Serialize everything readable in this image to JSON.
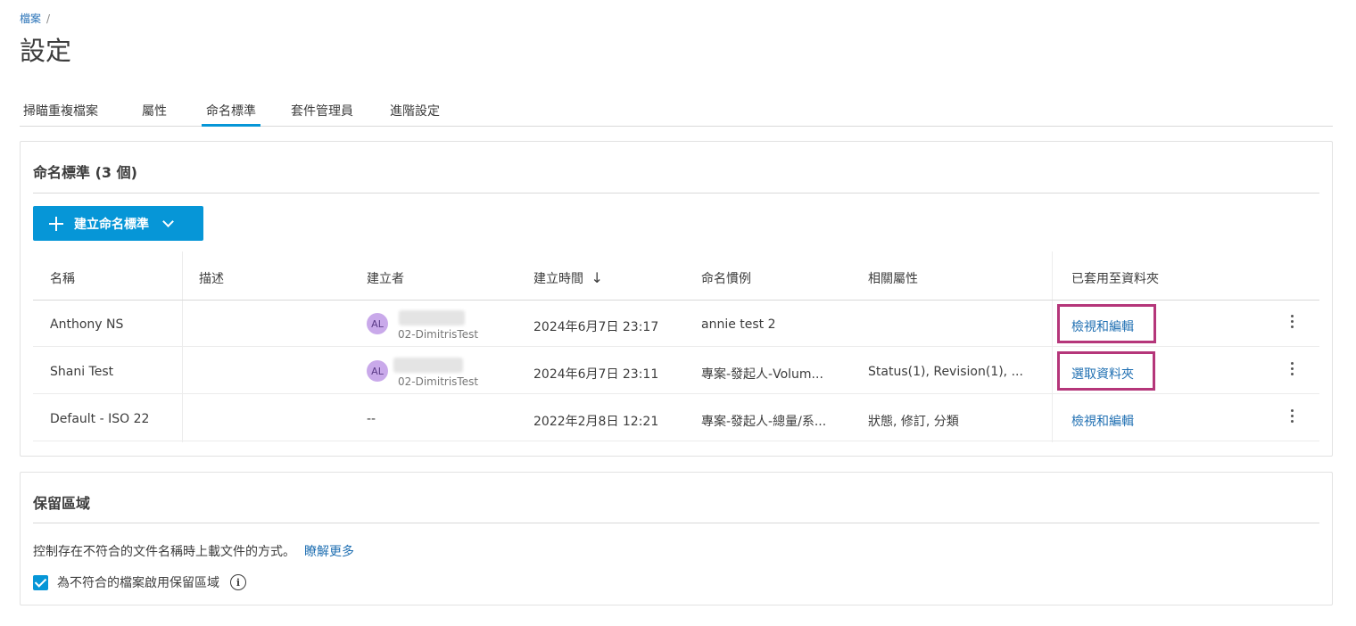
{
  "breadcrumb": {
    "root": "檔案",
    "separator": "/"
  },
  "page_title": "設定",
  "tabs": [
    {
      "label": "掃瞄重複檔案",
      "active": false
    },
    {
      "label": "屬性",
      "active": false
    },
    {
      "label": "命名標準",
      "active": true
    },
    {
      "label": "套件管理員",
      "active": false
    },
    {
      "label": "進階設定",
      "active": false
    }
  ],
  "naming": {
    "title": "命名標準 (3 個)",
    "create_button": "建立命名標準",
    "columns": [
      "名稱",
      "描述",
      "建立者",
      "建立時間",
      "命名慣例",
      "相關屬性",
      "已套用至資料夾"
    ],
    "rows": [
      {
        "name": "Anthony NS",
        "description": "",
        "creator_initials": "AL",
        "creator_sub": "02-DimitrisTest",
        "created": "2024年6月7日 23:17",
        "convention": "annie test 2",
        "attributes": "",
        "folder_action": "檢視和編輯"
      },
      {
        "name": "Shani Test",
        "description": "",
        "creator_initials": "AL",
        "creator_sub": "02-DimitrisTest",
        "created": "2024年6月7日 23:11",
        "convention": "專案-發起人-Volum...",
        "attributes": "Status(1), Revision(1), ...",
        "folder_action": "選取資料夾"
      },
      {
        "name": "Default - ISO 22",
        "description": "",
        "creator": "--",
        "created": "2022年2月8日 12:21",
        "convention": "專案-發起人-總量/系...",
        "attributes": "狀態, 修訂, 分類",
        "folder_action": "檢視和編輯"
      }
    ]
  },
  "hold": {
    "title": "保留區域",
    "description": "控制存在不符合的文件名稱時上載文件的方式。",
    "learn_more": "瞭解更多",
    "checkbox_label": "為不符合的檔案啟用保留區域",
    "checkbox_checked": true
  },
  "colors": {
    "accent": "#0696d7",
    "link": "#1f6fb2",
    "highlight": "#b5367a"
  }
}
